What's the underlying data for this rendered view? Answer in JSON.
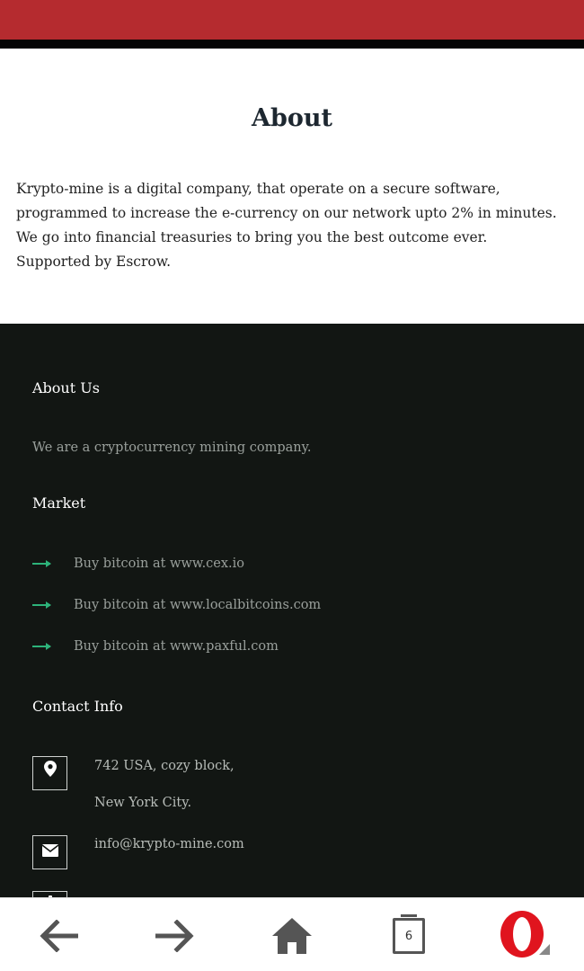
{
  "about": {
    "title": "About",
    "lines": [
      "Krypto-mine is a digital company, that operate on a secure software,",
      "programmed to increase the e-currency on our network upto 2% in minutes.",
      "We go into financial treasuries to bring you the best outcome ever.",
      "Supported by Escrow."
    ]
  },
  "footer": {
    "about_us_heading": "About Us",
    "about_us_text": "We are a cryptocurrency mining company.",
    "market_heading": "Market",
    "market_items": [
      "Buy bitcoin at www.cex.io",
      "Buy bitcoin at www.localbitcoins.com",
      "Buy bitcoin at www.paxful.com"
    ],
    "contact_heading": "Contact Info",
    "address_line1": "742 USA, cozy block,",
    "address_line2": "New York City.",
    "email": "info@krypto-mine.com"
  },
  "nav": {
    "tab_count": "6"
  },
  "colors": {
    "status_bar": "#b52b2f",
    "footer_bg": "#121613",
    "accent_arrow": "#2db37a",
    "opera_red": "#e0141e"
  }
}
